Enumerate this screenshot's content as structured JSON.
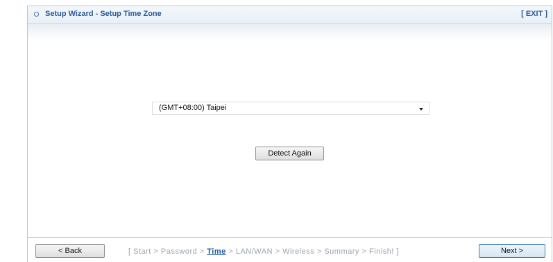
{
  "header": {
    "title": "Setup Wizard - Setup Time Zone",
    "exit_label": "[ EXIT ]"
  },
  "timezone": {
    "selected": "(GMT+08:00) Taipei"
  },
  "detect_label": "Detect Again",
  "footer": {
    "back_label": "< Back",
    "next_label": "Next >",
    "open_bracket": "[",
    "close_bracket": "]",
    "separator": ">",
    "steps": [
      "Start",
      "Password",
      "Time",
      "LAN/WAN",
      "Wireless",
      "Summary",
      "Finish!"
    ],
    "current_step": "Time"
  },
  "colors": {
    "accent": "#2a5a96",
    "current_step": "#1f5a9e",
    "inactive_step": "#9aa3ad"
  }
}
